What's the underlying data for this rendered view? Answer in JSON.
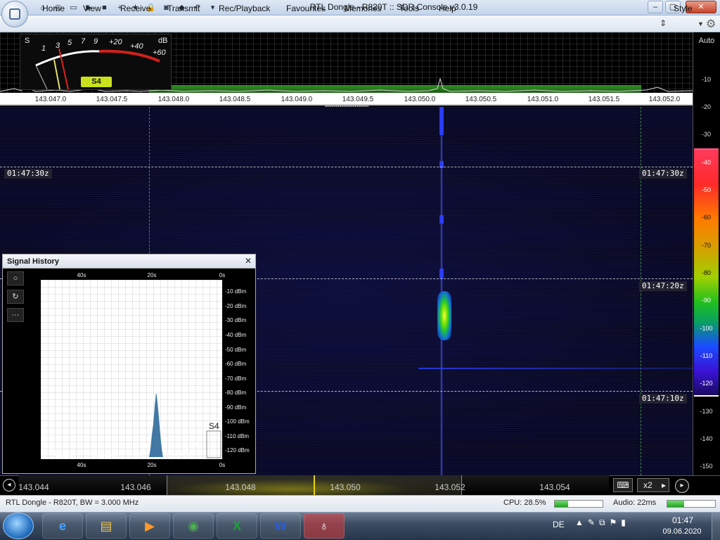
{
  "window": {
    "title": "RTL Dongle - R820T :: SDR Console v3.0.19",
    "buttons": {
      "minimize": "–",
      "maximize": "▢",
      "close": "✕"
    }
  },
  "quick_access": [
    "home-icon",
    "lifebuoy-icon",
    "folder-icon",
    "play-icon",
    "stop-icon",
    "add-icon",
    "star-icon",
    "lock-icon",
    "camera-icon",
    "drop-icon",
    "undo-icon",
    "dropdown-icon"
  ],
  "menu": {
    "items": [
      "Home",
      "View",
      "Receive",
      "Transmit",
      "Rec/Playback",
      "Favourites",
      "Memories",
      "Tools",
      "Help"
    ],
    "style": "Style"
  },
  "smeter": {
    "s_label": "S",
    "db_label": "dB",
    "scale_s": [
      "1",
      "3",
      "5",
      "7",
      "9"
    ],
    "scale_db": [
      "+20",
      "+40",
      "+60"
    ],
    "reading": "S4"
  },
  "spectrum": {
    "freq_ticks": [
      "143.047.0",
      "143.047.5",
      "143.048.0",
      "143.048.5",
      "143.049.0",
      "143.049.5",
      "143.050.0",
      "143.050.5",
      "143.051.0",
      "143.051.5",
      "143.052.0"
    ]
  },
  "db_scale": {
    "auto_label": "Auto",
    "top_ticks": [
      "-10",
      "-20",
      "-30"
    ],
    "colorbar_ticks": [
      "-40",
      "-50",
      "-60",
      "-70",
      "-80",
      "-90",
      "-100",
      "-110",
      "-120"
    ],
    "bottom_ticks": [
      "-130",
      "-140",
      "-150"
    ]
  },
  "waterfall": {
    "time_labels": [
      "01:47:30z",
      "01:47:20z",
      "01:47:10z"
    ]
  },
  "signal_history": {
    "title": "Signal History",
    "close": "✕",
    "tools": [
      "○",
      "↻",
      "···"
    ],
    "x_labels_top": [
      "40s",
      "20s",
      "0s"
    ],
    "x_labels_bottom": [
      "40s",
      "20s",
      "0s"
    ],
    "y_labels": [
      "-10 dBm",
      "-20 dBm",
      "-30 dBm",
      "-40 dBm",
      "-50 dBm",
      "-60 dBm",
      "-70 dBm",
      "-80 dBm",
      "-90 dBm",
      "-100 dBm",
      "-110 dBm",
      "-120 dBm"
    ],
    "s_reading": "S4"
  },
  "tuner": {
    "freqs": [
      "143.044",
      "143.046",
      "143.048",
      "143.050",
      "143.052",
      "143.054"
    ],
    "keyboard_icon": "⌨",
    "zoom": "x2",
    "zoom_arrow": "▸",
    "left_arrow": "◂",
    "right_arrow": "▸"
  },
  "status": {
    "text": "RTL Dongle - R820T, BW = 3.000 MHz",
    "cpu": "CPU: 28.5%",
    "cpu_fraction": 0.285,
    "audio": "Audio: 22ms",
    "audio_fraction": 0.35
  },
  "taskbar": {
    "apps": [
      {
        "name": "internet-explorer",
        "glyph": "e",
        "color": "#49a3ff"
      },
      {
        "name": "file-explorer",
        "glyph": "▤",
        "color": "#f0c24a"
      },
      {
        "name": "media-player",
        "glyph": "▶",
        "color": "#ff9a2a"
      },
      {
        "name": "chrome",
        "glyph": "◉",
        "color": "#4caf50"
      },
      {
        "name": "excel",
        "glyph": "X",
        "color": "#1f9e3a"
      },
      {
        "name": "word",
        "glyph": "W",
        "color": "#2a5bd6"
      },
      {
        "name": "sdr-console",
        "glyph": "♁",
        "color": "#ffffff"
      }
    ],
    "language": "DE",
    "tray_icons": [
      "▲",
      "✎",
      "⧉",
      "⚑",
      "▮"
    ],
    "time": "01:47",
    "date": "09.06.2020"
  }
}
